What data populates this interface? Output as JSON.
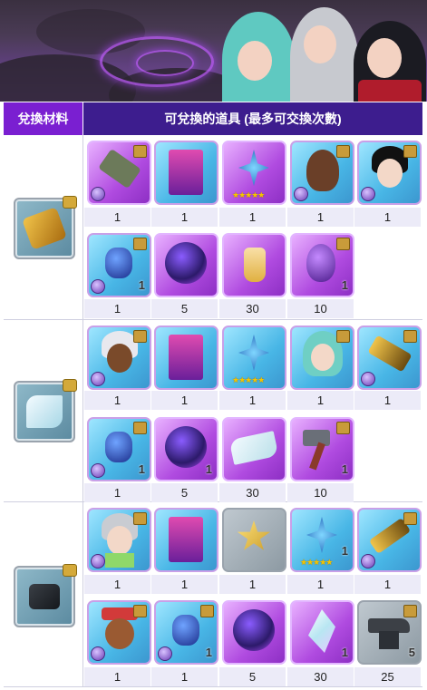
{
  "header": {
    "materials_label": "兌換材料",
    "items_label": "可兌換的道具 (最多可交換次數)"
  },
  "sections": [
    {
      "material_icon": "gold-claw-icon",
      "rows": [
        [
          {
            "icon": "gun-weapon-icon",
            "quantity": "1"
          },
          {
            "icon": "card-pack-icon",
            "quantity": "1"
          },
          {
            "icon": "blue-star-emblem-icon",
            "quantity": "1"
          },
          {
            "icon": "character-portrait-icon",
            "quantity": "1"
          },
          {
            "icon": "character-portrait-icon",
            "quantity": "1"
          }
        ],
        [
          {
            "icon": "blue-gem-pendant-icon",
            "quantity": "1"
          },
          {
            "icon": "spirit-orb-icon",
            "quantity": "5"
          },
          {
            "icon": "potion-bottle-icon",
            "quantity": "30"
          },
          {
            "icon": "purple-egg-icon",
            "quantity": "10"
          }
        ]
      ]
    },
    {
      "material_icon": "cloth-icon",
      "rows": [
        [
          {
            "icon": "character-portrait-icon",
            "quantity": "1"
          },
          {
            "icon": "card-pack-icon",
            "quantity": "1"
          },
          {
            "icon": "blue-star-emblem-icon",
            "quantity": "1"
          },
          {
            "icon": "character-portrait-icon",
            "quantity": "1"
          },
          {
            "icon": "gold-weapon-icon",
            "quantity": "1"
          }
        ],
        [
          {
            "icon": "blue-gem-pendant-icon",
            "quantity": "1"
          },
          {
            "icon": "spirit-orb-icon",
            "quantity": "5"
          },
          {
            "icon": "cloth-icon",
            "quantity": "30"
          },
          {
            "icon": "hammer-icon",
            "quantity": "10"
          }
        ]
      ]
    },
    {
      "material_icon": "device-icon",
      "rows": [
        [
          {
            "icon": "character-portrait-icon",
            "quantity": "1"
          },
          {
            "icon": "card-pack-icon",
            "quantity": "1"
          },
          {
            "icon": "gold-star-icon",
            "quantity": "1"
          },
          {
            "icon": "blue-star-emblem-icon",
            "quantity": "1"
          },
          {
            "icon": "gold-weapon-icon",
            "quantity": "1"
          }
        ],
        [
          {
            "icon": "character-portrait-icon",
            "quantity": "1"
          },
          {
            "icon": "blue-gem-pendant-icon",
            "quantity": "1"
          },
          {
            "icon": "spirit-orb-icon",
            "quantity": "5"
          },
          {
            "icon": "crystal-shard-icon",
            "quantity": "30"
          },
          {
            "icon": "anvil-icon",
            "quantity": "25"
          }
        ]
      ]
    }
  ],
  "item_overlays": {
    "count_label": "1",
    "anvil_count_label": "5",
    "stars": "★★★★★"
  }
}
